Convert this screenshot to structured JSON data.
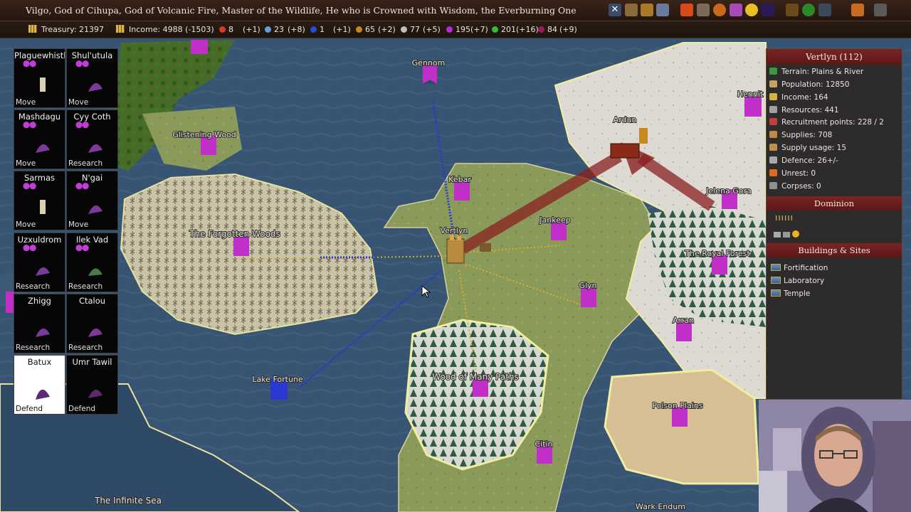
{
  "title_bar": {
    "title": "Vilgo, God of Cihupa, God of Volcanic Fire, Master of the Wildlife, He who is Crowned with Wisdom, the Everburning One",
    "icons": [
      "close-x-icon",
      "army-icon",
      "research-icon",
      "armor-icon",
      "fire-icon",
      "wand-icon",
      "pumpkin-icon",
      "magic-icon",
      "gold-orb-icon",
      "globe-icon",
      "star-icon",
      "chest-icon",
      "tree-icon",
      "ship-icon",
      "candle-icon",
      "menu-icon"
    ]
  },
  "stats": {
    "treasury": "Treasury: 21397",
    "income": "Income: 4988 (-1503)",
    "fire": "8",
    "fire_delta": "(+1)",
    "air": "23",
    "air_delta": "(+8)",
    "water": "1",
    "water_delta": "(+1)",
    "earth": "65",
    "earth_delta": "(+2)",
    "astral": "77",
    "astral_delta": "(+5)",
    "death": "195(+7)",
    "nature": "201(+16)",
    "blood": "84",
    "blood_delta": "(+9)",
    "colors": {
      "fire": "#d63a2a",
      "air": "#6a9ad8",
      "water": "#2a4ad0",
      "earth": "#c8861e",
      "astral": "#bdbdbd",
      "death": "#b42ad8",
      "nature": "#3ab83a",
      "blood": "#9a1a5a"
    }
  },
  "commanders": [
    {
      "name": "Plaguewhistl",
      "order": "Move",
      "selected": false
    },
    {
      "name": "Shul'utula",
      "order": "Move",
      "selected": false
    },
    {
      "name": "Mashdagu",
      "order": "Move",
      "selected": false
    },
    {
      "name": "Cyy Coth",
      "order": "Research",
      "selected": false
    },
    {
      "name": "Sarmas",
      "order": "Move",
      "selected": false
    },
    {
      "name": "N'gai",
      "order": "Move",
      "selected": false
    },
    {
      "name": "Uzxuldrom",
      "order": "Research",
      "selected": false
    },
    {
      "name": "Ilek Vad",
      "order": "Research",
      "selected": false
    },
    {
      "name": "Zhigg",
      "order": "Research",
      "selected": false
    },
    {
      "name": "Ctalou",
      "order": "Research",
      "selected": false
    },
    {
      "name": "Batux",
      "order": "Defend",
      "selected": true
    },
    {
      "name": "Umr Tawil",
      "order": "Defend",
      "selected": false
    }
  ],
  "province_info": {
    "title": "Vertlyn (112)",
    "rows": [
      {
        "icon": "terrain-icon",
        "text": "Terrain: Plains & River",
        "color": "#3a9a3a"
      },
      {
        "icon": "population-icon",
        "text": "Population: 12850",
        "color": "#c8a060"
      },
      {
        "icon": "income-icon",
        "text": "Income: 164",
        "color": "#d8b040"
      },
      {
        "icon": "resources-icon",
        "text": "Resources: 441",
        "color": "#a0a0a0"
      },
      {
        "icon": "recruitment-icon",
        "text": "Recruitment points: 228 / 2",
        "color": "#c04040"
      },
      {
        "icon": "supplies-icon",
        "text": "Supplies: 708",
        "color": "#c08840"
      },
      {
        "icon": "supply-usage-icon",
        "text": "Supply usage: 15",
        "color": "#c09048"
      },
      {
        "icon": "defence-icon",
        "text": "Defence: 26+/-",
        "color": "#a8a8a8"
      },
      {
        "icon": "unrest-icon",
        "text": "Unrest: 0",
        "color": "#e06a20"
      },
      {
        "icon": "corpses-icon",
        "text": "Corpses: 0",
        "color": "#909090"
      }
    ],
    "dominion_title": "Dominion",
    "buildings_title": "Buildings & Sites",
    "buildings": [
      "Fortification",
      "Laboratory",
      "Temple"
    ]
  },
  "map_labels": {
    "gennom": "Gennom",
    "glistening_wood": "Glistening Wood",
    "kebar": "Kebar",
    "ardun": "Ardun",
    "hennit": "Hennit",
    "jankeep": "Jankeep",
    "jelena_gora": "Jelena Gora",
    "vertlyn": "Vertlyn",
    "forgotten_woods": "The Forgotten Woods",
    "royal_forest": "The Royal Forest",
    "glyn": "Glyn",
    "arran": "Arran",
    "lake_fortune": "Lake Fortune",
    "wood_many_paths": "Wood of Many Paths",
    "poison_plains": "Poison Plains",
    "citin": "Citin",
    "infinite_sea": "The Infinite Sea",
    "wark_endum": "Wark Endum"
  }
}
